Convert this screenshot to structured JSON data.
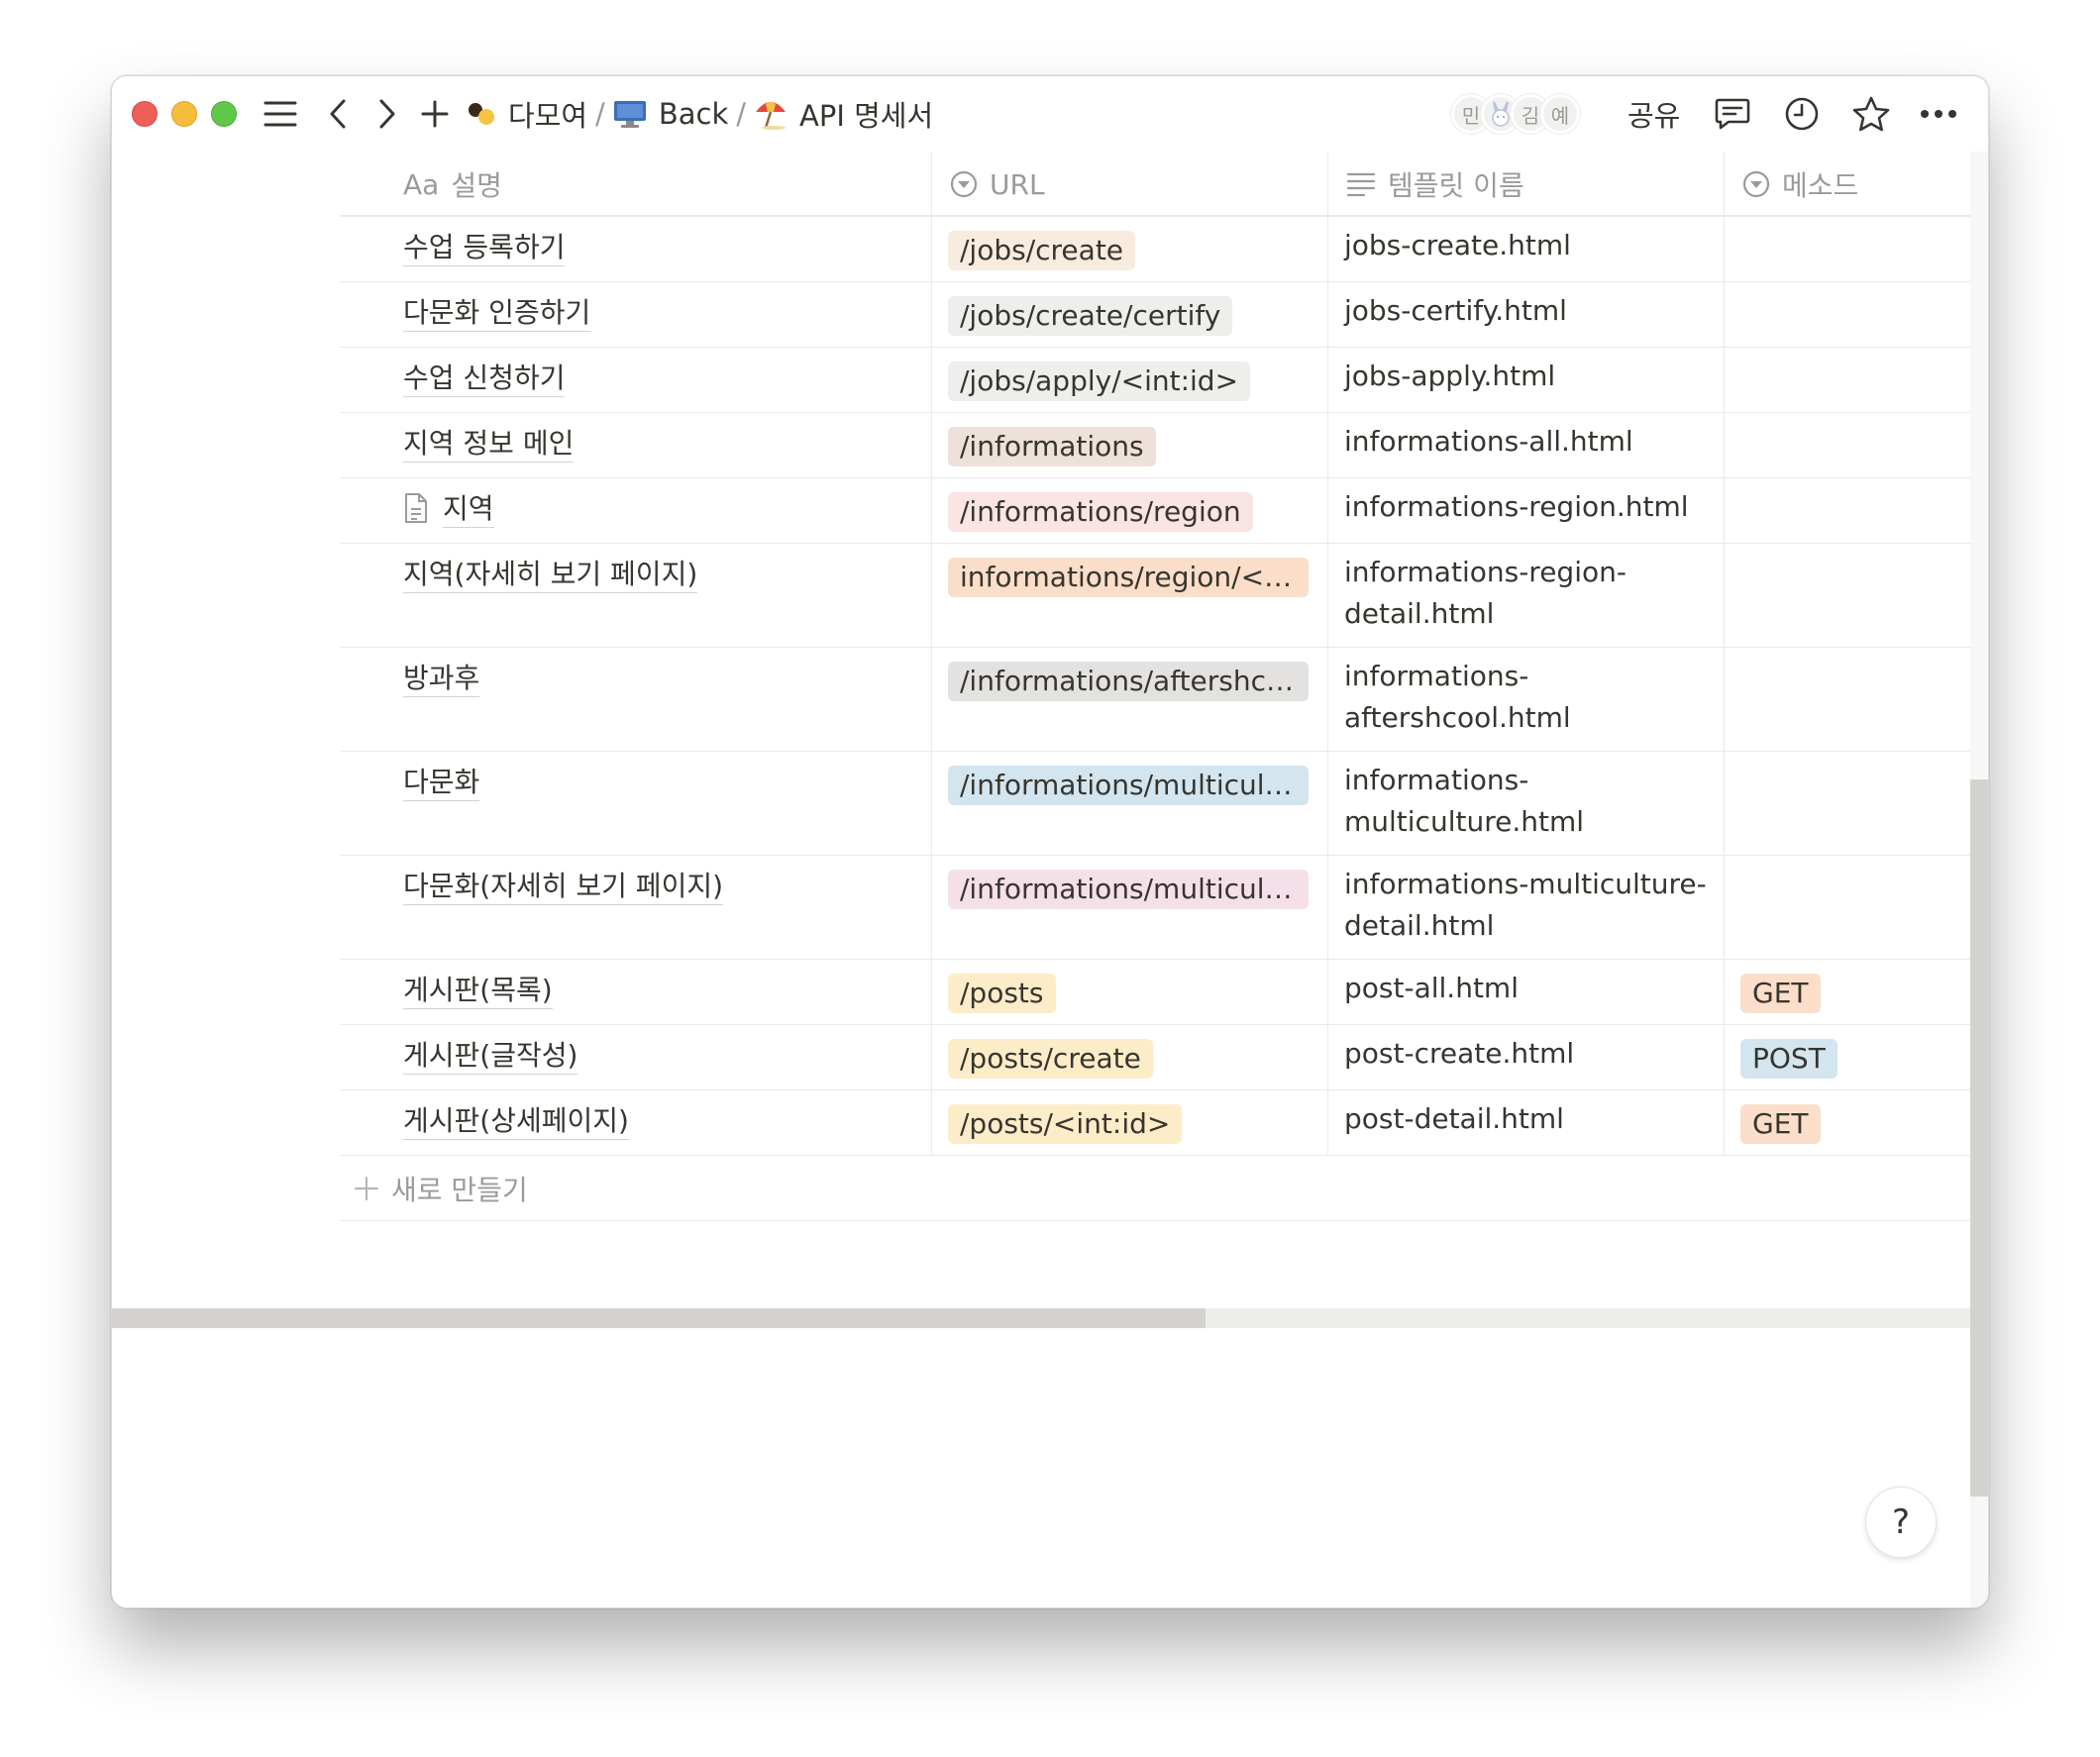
{
  "breadcrumbs": [
    {
      "label": "다모여",
      "icon": "workspace-emoji-icon"
    },
    {
      "label": "Back",
      "icon": "desktop-computer-icon"
    },
    {
      "label": "API 명세서",
      "icon": "beach-umbrella-icon"
    }
  ],
  "separator": "/",
  "avatars": [
    "민",
    "",
    "김",
    "예"
  ],
  "share_label": "공유",
  "table": {
    "columns": [
      {
        "icon": "text-icon",
        "icon_text": "Aa",
        "label": "설명"
      },
      {
        "icon": "select-icon",
        "label": "URL"
      },
      {
        "icon": "lines-icon",
        "label": "템플릿 이름"
      },
      {
        "icon": "select-icon",
        "label": "메소드"
      }
    ],
    "rows": [
      {
        "name": "수업 등록하기",
        "url": "/jobs/create",
        "url_color": "#f8ecdf",
        "template": "jobs-create.html",
        "method": ""
      },
      {
        "name": "다문화 인증하기",
        "url": "/jobs/create/certify",
        "url_color": "#eeeeed",
        "template": "jobs-certify.html",
        "method": ""
      },
      {
        "name": "수업 신청하기",
        "url": "/jobs/apply/<int:id>",
        "url_color": "#eeeeed",
        "template": "jobs-apply.html",
        "method": ""
      },
      {
        "name": "지역 정보 메인",
        "url": "/informations",
        "url_color": "#eee0da",
        "template": "informations-all.html",
        "method": ""
      },
      {
        "name": "지역",
        "doc_icon": true,
        "url": "/informations/region",
        "url_color": "#fbe4e4",
        "template": "informations-region.html",
        "method": ""
      },
      {
        "name": "지역(자세히 보기 페이지)",
        "url": "informations/region/<int:...",
        "url_color": "#fadec9",
        "template": "informations-region-detail.html",
        "method": ""
      },
      {
        "name": "방과후",
        "url": "/informations/aftershcool",
        "url_color": "#e3e2e0",
        "template": "informations-aftershcool.html",
        "method": ""
      },
      {
        "name": "다문화",
        "url": "/informations/multicultural",
        "url_color": "#d3e5ef",
        "template": "informations-multiculture.html",
        "method": ""
      },
      {
        "name": "다문화(자세히 보기 페이지)",
        "url": "/informations/multicultur...",
        "url_color": "#f5e0e9",
        "template": "informations-multiculture-detail.html",
        "method": ""
      },
      {
        "name": "게시판(목록)",
        "url": "/posts",
        "url_color": "#fdecc8",
        "template": "post-all.html",
        "method": "GET",
        "method_color": "#fadec9"
      },
      {
        "name": "게시판(글작성)",
        "url": "/posts/create",
        "url_color": "#fdecc8",
        "template": "post-create.html",
        "method": "POST",
        "method_color": "#d3e5ef"
      },
      {
        "name": "게시판(상세페이지)",
        "url": "/posts/<int:id>",
        "url_color": "#fdecc8",
        "template": "post-detail.html",
        "method": "GET",
        "method_color": "#fadec9"
      }
    ],
    "new_row_label": "새로 만들기"
  },
  "help_label": "?"
}
